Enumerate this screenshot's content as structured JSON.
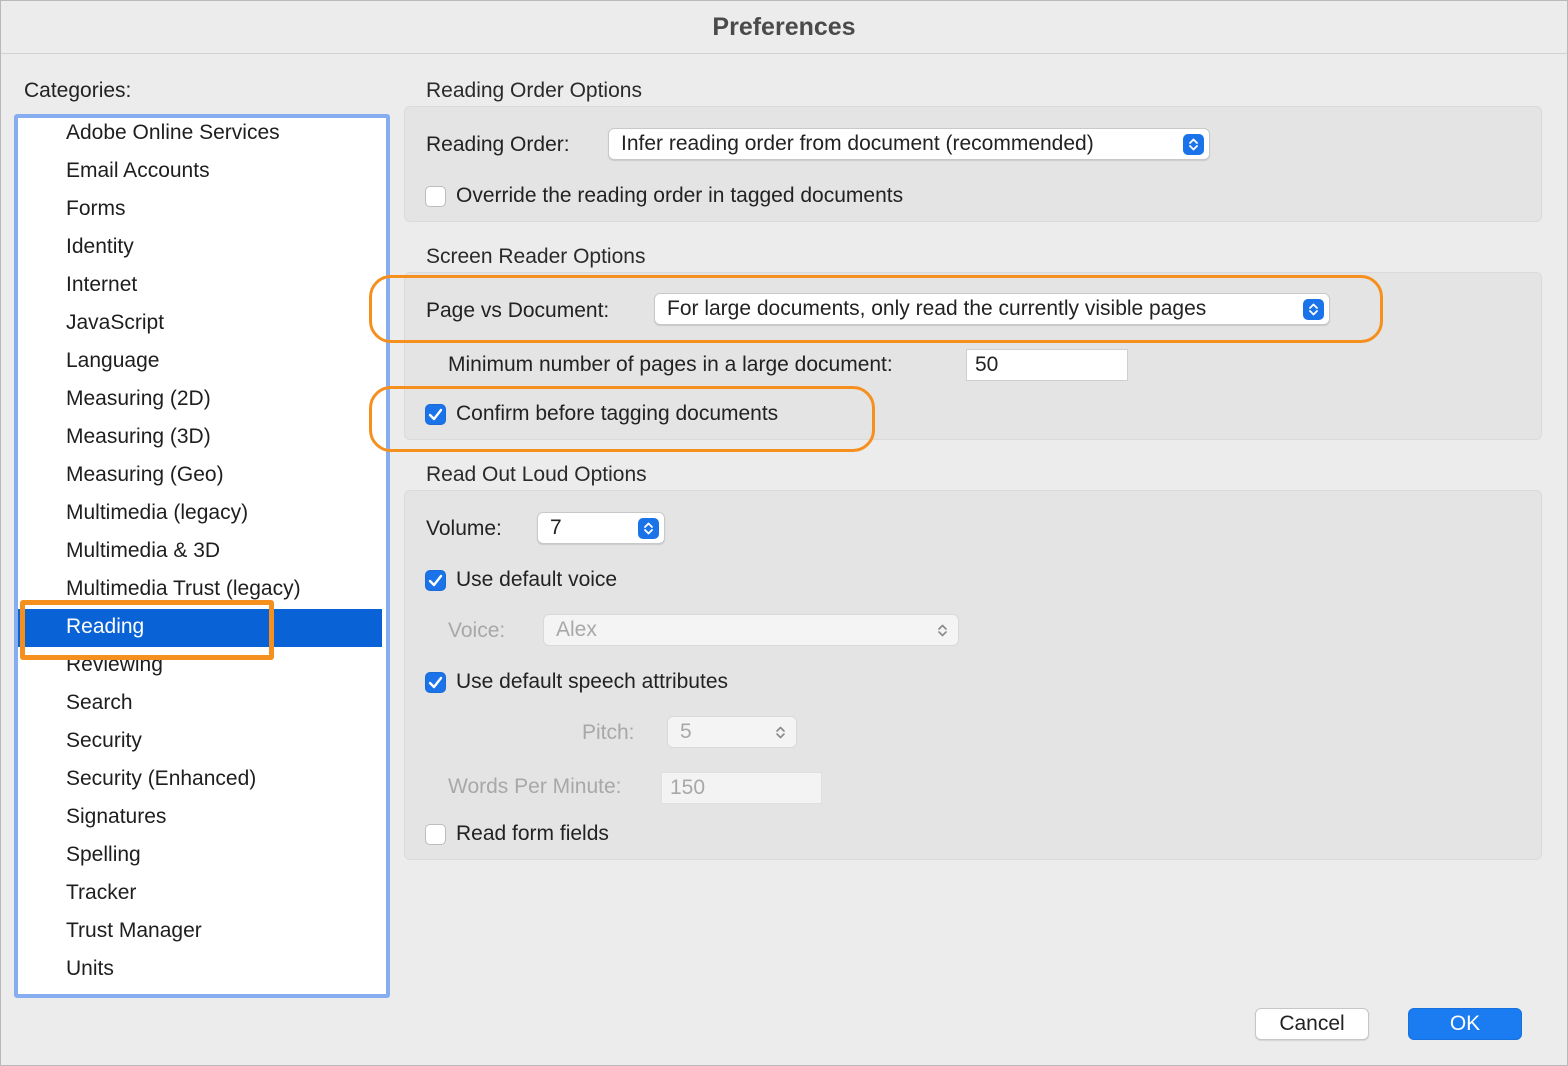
{
  "window": {
    "title": "Preferences"
  },
  "categories": {
    "label": "Categories:",
    "items": [
      "Adobe Online Services",
      "Email Accounts",
      "Forms",
      "Identity",
      "Internet",
      "JavaScript",
      "Language",
      "Measuring (2D)",
      "Measuring (3D)",
      "Measuring (Geo)",
      "Multimedia (legacy)",
      "Multimedia & 3D",
      "Multimedia Trust (legacy)",
      "Reading",
      "Reviewing",
      "Search",
      "Security",
      "Security (Enhanced)",
      "Signatures",
      "Spelling",
      "Tracker",
      "Trust Manager",
      "Units"
    ],
    "selected": "Reading"
  },
  "reading_order": {
    "section_title": "Reading Order Options",
    "order_label": "Reading Order:",
    "order_value": "Infer reading order from document (recommended)",
    "override_label": "Override the reading order in tagged documents",
    "override_checked": false
  },
  "screen_reader": {
    "section_title": "Screen Reader Options",
    "page_vs_doc_label": "Page vs Document:",
    "page_vs_doc_value": "For large documents, only read the currently visible pages",
    "min_pages_label": "Minimum number of pages in a large document:",
    "min_pages_value": "50",
    "confirm_label": "Confirm before tagging documents",
    "confirm_checked": true
  },
  "read_out_loud": {
    "section_title": "Read Out Loud Options",
    "volume_label": "Volume:",
    "volume_value": "7",
    "default_voice_label": "Use default voice",
    "default_voice_checked": true,
    "voice_label": "Voice:",
    "voice_value": "Alex",
    "default_speech_label": "Use default speech attributes",
    "default_speech_checked": true,
    "pitch_label": "Pitch:",
    "pitch_value": "5",
    "wpm_label": "Words Per Minute:",
    "wpm_value": "150",
    "form_fields_label": "Read form fields",
    "form_fields_checked": false
  },
  "buttons": {
    "cancel": "Cancel",
    "ok": "OK"
  },
  "colors": {
    "accent": "#1a73e8",
    "selection": "#0a63d6",
    "highlight": "#f5901e",
    "list_border": "#86adef"
  }
}
